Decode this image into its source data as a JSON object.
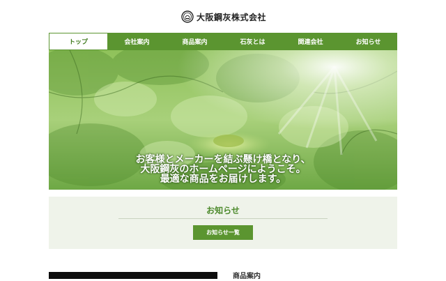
{
  "header": {
    "company_name": "大阪鋼灰株式会社",
    "logo_icon": "company-logo-icon"
  },
  "nav": {
    "items": [
      {
        "label": "トップ",
        "active": true
      },
      {
        "label": "会社案内",
        "active": false
      },
      {
        "label": "商品案内",
        "active": false
      },
      {
        "label": "石灰とは",
        "active": false
      },
      {
        "label": "関連会社",
        "active": false
      },
      {
        "label": "お知らせ",
        "active": false
      }
    ]
  },
  "hero": {
    "line1": "お客様とメーカーを結ぶ懸け橋となり、",
    "line2": "大阪鋼灰のホームページにようこそ。",
    "line3": "最適な商品をお届けします。"
  },
  "news": {
    "title": "お知らせ",
    "button_label": "お知らせ一覧"
  },
  "products": {
    "heading": "商品案内"
  },
  "colors": {
    "accent": "#5b9530",
    "accent_text": "#4d8a2c",
    "panel_bg": "#eff3ea"
  }
}
